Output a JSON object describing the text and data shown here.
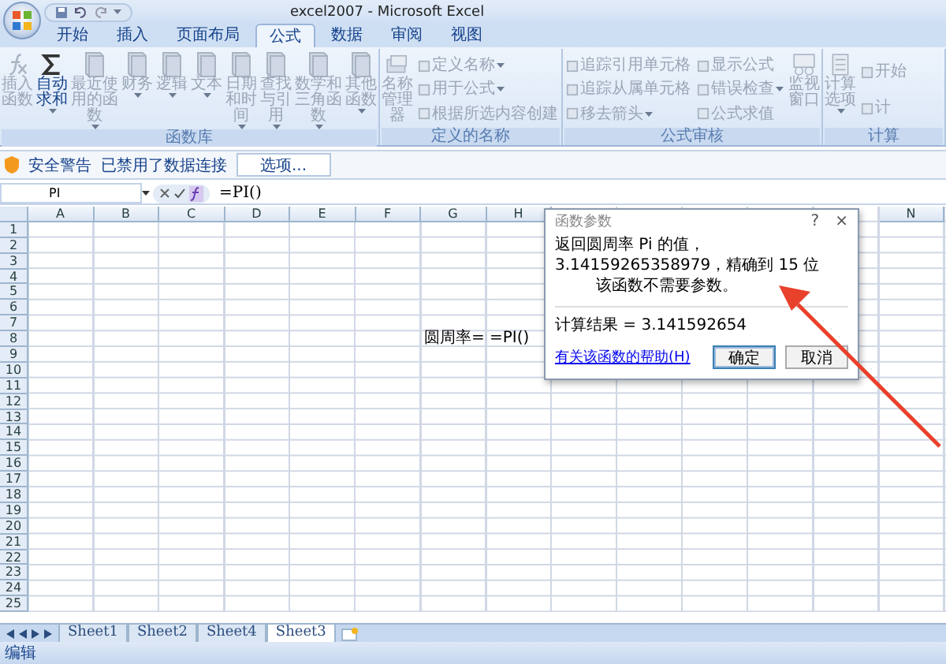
{
  "window": {
    "title": "excel2007 - Microsoft Excel"
  },
  "tabs": [
    {
      "label": "开始",
      "selected": false
    },
    {
      "label": "插入",
      "selected": false
    },
    {
      "label": "页面布局",
      "selected": false
    },
    {
      "label": "公式",
      "selected": true
    },
    {
      "label": "数据",
      "selected": false
    },
    {
      "label": "审阅",
      "selected": false
    },
    {
      "label": "视图",
      "selected": false
    }
  ],
  "ribbon": {
    "groups": [
      {
        "title": "函数库",
        "items": [
          {
            "kind": "insert-function",
            "label": "插入函数",
            "disabled": true,
            "dropdown": false
          },
          {
            "kind": "autosum",
            "label": "自动求和",
            "disabled": false,
            "dropdown": true
          },
          {
            "kind": "category",
            "label": "最近使用的函数",
            "disabled": true,
            "dropdown": true
          },
          {
            "kind": "category",
            "label": "财务",
            "disabled": true,
            "dropdown": true
          },
          {
            "kind": "category",
            "label": "逻辑",
            "disabled": true,
            "dropdown": true
          },
          {
            "kind": "category",
            "label": "文本",
            "disabled": true,
            "dropdown": true
          },
          {
            "kind": "category",
            "label": "日期和时间",
            "disabled": true,
            "dropdown": true
          },
          {
            "kind": "category",
            "label": "查找与引用",
            "disabled": true,
            "dropdown": true
          },
          {
            "kind": "category",
            "label": "数学和三角函数",
            "disabled": true,
            "dropdown": true
          },
          {
            "kind": "category",
            "label": "其他函数",
            "disabled": true,
            "dropdown": true
          }
        ]
      },
      {
        "title": "定义的名称",
        "items": [
          {
            "kind": "name-manager",
            "label": "名称管理器",
            "disabled": true,
            "dropdown": false
          },
          {
            "kind": "column",
            "entries": [
              {
                "label": "定义名称",
                "dropdown": true
              },
              {
                "label": "用于公式",
                "dropdown": true
              },
              {
                "label": "根据所选内容创建",
                "dropdown": false
              }
            ]
          }
        ]
      },
      {
        "title": "公式审核",
        "items": [
          {
            "kind": "column",
            "entries": [
              {
                "label": "追踪引用单元格",
                "dropdown": false
              },
              {
                "label": "追踪从属单元格",
                "dropdown": false
              },
              {
                "label": "移去箭头",
                "dropdown": true
              }
            ]
          },
          {
            "kind": "column",
            "entries": [
              {
                "label": "显示公式",
                "dropdown": false
              },
              {
                "label": "错误检查",
                "dropdown": true
              },
              {
                "label": "公式求值",
                "dropdown": false
              }
            ]
          },
          {
            "kind": "watch",
            "label": "监视窗口",
            "disabled": true,
            "dropdown": false
          }
        ]
      },
      {
        "title": "计算",
        "items": [
          {
            "kind": "calc-options",
            "label": "计算选项",
            "disabled": true,
            "dropdown": true
          },
          {
            "kind": "column",
            "entries": [
              {
                "label": "开始",
                "dropdown": false
              },
              {
                "label": "计",
                "dropdown": false
              }
            ]
          }
        ]
      }
    ]
  },
  "security_bar": {
    "title": "安全警告",
    "message": "已禁用了数据连接",
    "button": "选项..."
  },
  "formula_bar": {
    "name_box": "PI",
    "formula": "=PI()"
  },
  "sheet": {
    "columns": [
      "A",
      "B",
      "C",
      "D",
      "E",
      "F",
      "G",
      "H",
      "N"
    ],
    "rows": [
      {
        "header": "1"
      },
      {
        "header": "2"
      },
      {
        "header": "3"
      },
      {
        "header": "4"
      },
      {
        "header": "5"
      },
      {
        "header": "6"
      },
      {
        "header": "7"
      },
      {
        "header": "8",
        "cells": [
          "圆周率=",
          "=PI()"
        ]
      },
      {
        "header": "9"
      },
      {
        "header": "10"
      },
      {
        "header": "11"
      },
      {
        "header": "12"
      },
      {
        "header": "13"
      },
      {
        "header": "14"
      },
      {
        "header": "15"
      },
      {
        "header": "16"
      },
      {
        "header": "17"
      },
      {
        "header": "18"
      },
      {
        "header": "19"
      },
      {
        "header": "20"
      },
      {
        "header": "21"
      },
      {
        "header": "22"
      },
      {
        "header": "23"
      },
      {
        "header": "24"
      },
      {
        "header": "25"
      }
    ]
  },
  "dialog": {
    "title": "函数参数",
    "help": "?",
    "close": "×",
    "description": "返回圆周率 Pi 的值，3.14159265358979，精确到 15 位",
    "note": "该函数不需要参数。",
    "result": "计算结果 = 3.141592654",
    "link": "有关该函数的帮助(H)",
    "buttons": [
      {
        "label": "确定",
        "selected": true
      },
      {
        "label": "取消",
        "selected": false
      }
    ]
  },
  "sheet_tabs": [
    {
      "label": "Sheet1",
      "selected": false
    },
    {
      "label": "Sheet2",
      "selected": false
    },
    {
      "label": "Sheet4",
      "selected": false
    },
    {
      "label": "Sheet3",
      "selected": true
    }
  ],
  "status_bar": {
    "mode": "编辑"
  }
}
